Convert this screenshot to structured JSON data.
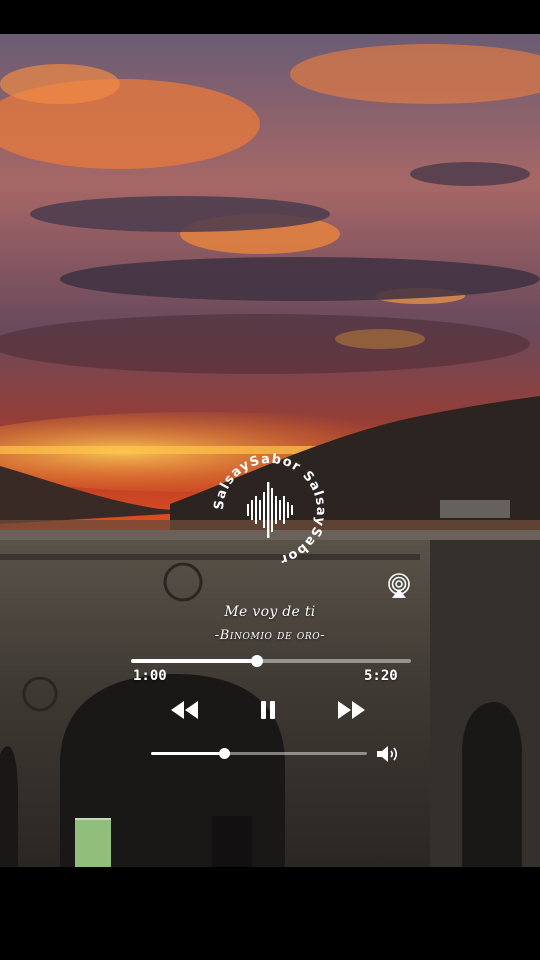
{
  "logo": {
    "text": "SalsaySabor SalsaySabor ",
    "icon": "soundwave-icon"
  },
  "player": {
    "song_title": "Me voy de ti",
    "artist": "-Binomio de oro-",
    "elapsed": "1:00",
    "total": "5:20",
    "progress": 0.45,
    "volume": 0.34,
    "icons": {
      "airplay": "airplay-icon",
      "rewind": "rewind-icon",
      "pause": "pause-icon",
      "fast_forward": "fast-forward-icon",
      "volume": "speaker-volume-icon"
    }
  },
  "colors": {
    "accent": "#ffffff",
    "sky_top": "#5a4f63",
    "sky_glow": "#f0521e",
    "horizon": "#ffb53a",
    "stone": "#3f3a34"
  }
}
